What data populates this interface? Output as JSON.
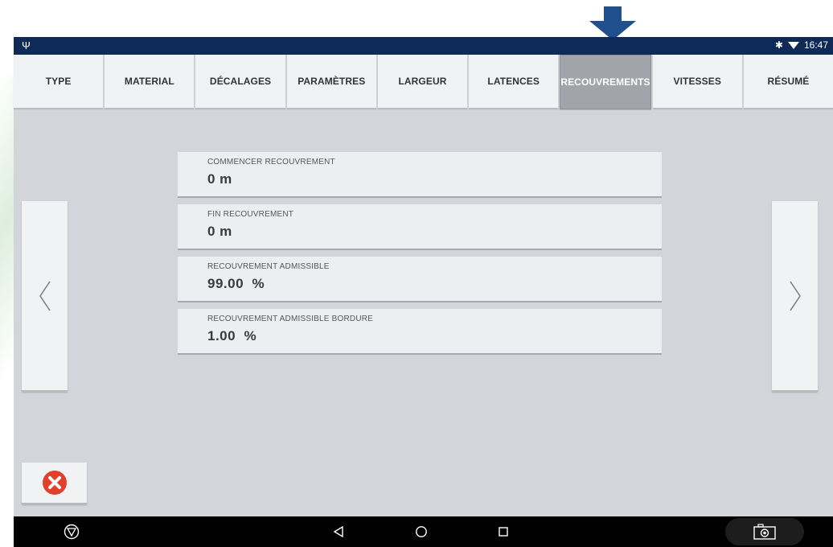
{
  "status_bar": {
    "time": "16:47",
    "icons": [
      "usb-icon",
      "bluetooth-icon",
      "wifi-icon"
    ]
  },
  "tabs": [
    {
      "label": "TYPE",
      "active": false
    },
    {
      "label": "MATERIAL",
      "active": false
    },
    {
      "label": "DÉCALAGES",
      "active": false
    },
    {
      "label": "PARAMÈTRES",
      "active": false
    },
    {
      "label": "LARGEUR",
      "active": false
    },
    {
      "label": "LATENCES",
      "active": false
    },
    {
      "label": "RECOUVREMENTS",
      "active": true
    },
    {
      "label": "VITESSES",
      "active": false
    },
    {
      "label": "RÉSUMÉ",
      "active": false
    }
  ],
  "fields": [
    {
      "label": "COMMENCER RECOUVREMENT",
      "value": "0 m"
    },
    {
      "label": "FIN RECOUVREMENT",
      "value": "0 m"
    },
    {
      "label": "RECOUVREMENT ADMISSIBLE",
      "value": "99.00  %"
    },
    {
      "label": "RECOUVREMENT ADMISSIBLE BORDURE",
      "value": "1.00  %"
    }
  ],
  "nav": {
    "prev_icon": "chevron-left-icon",
    "next_icon": "chevron-right-icon",
    "cancel_icon": "close-circle-icon"
  },
  "system_nav": {
    "icons": [
      "brand-logo-icon",
      "back-icon",
      "home-icon",
      "recents-icon",
      "camera-icon"
    ]
  },
  "colors": {
    "status_bar": "#0e2a57",
    "pointer_arrow": "#1f4f8c",
    "app_background": "#d3d5da",
    "active_tab": "#a2a4a9",
    "cancel_red": "#e0402c"
  }
}
